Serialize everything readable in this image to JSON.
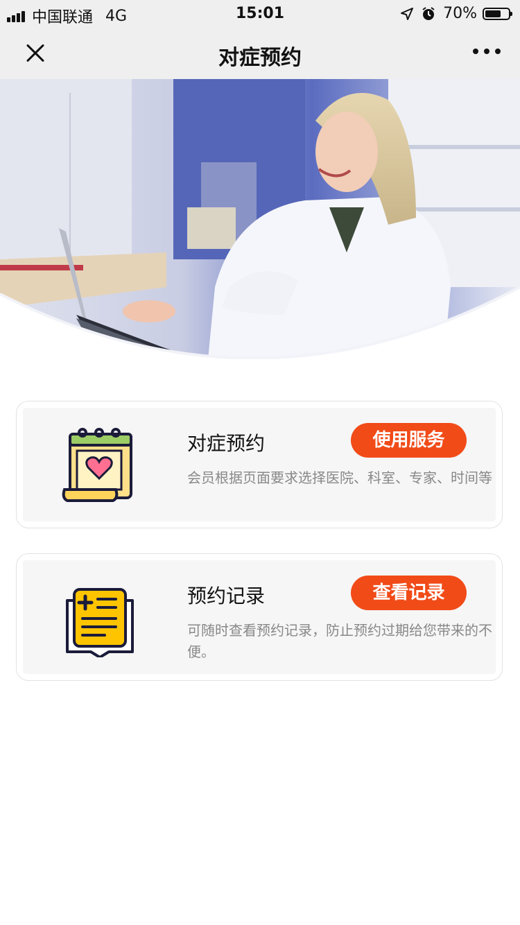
{
  "status_bar": {
    "carrier": "中国联通",
    "network": "4G",
    "time": "15:01",
    "battery_percent": "70%",
    "battery_level": 0.7,
    "icons": [
      "signal-icon",
      "location-arrow-icon",
      "alarm-icon",
      "battery-icon"
    ]
  },
  "nav": {
    "title": "对症预约",
    "close_icon": "close-icon",
    "more_icon": "more-dots-icon"
  },
  "banner": {
    "image": "doctor-at-laptop-photo"
  },
  "cards": [
    {
      "title": "对症预约",
      "button": "使用服务",
      "description": "会员根据页面要求选择医院、科室、专家、时间等",
      "icon": "calendar-heart-icon"
    },
    {
      "title": "预约记录",
      "button": "查看记录",
      "description": "可随时查看预约记录，防止预约过期给您带来的不便。",
      "icon": "medical-record-icon"
    }
  ],
  "colors": {
    "accent": "#f14b18",
    "bar_background": "#efefef",
    "card_background": "#f6f6f6"
  }
}
